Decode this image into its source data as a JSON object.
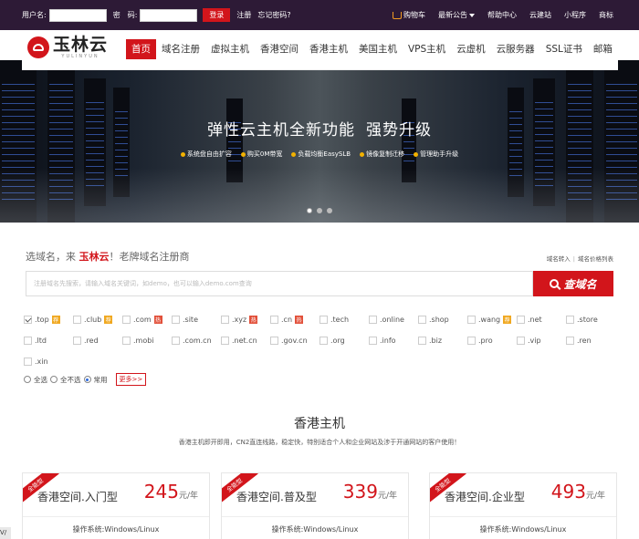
{
  "topbar": {
    "username_label": "用户名:",
    "password_label": "密　码:",
    "login_button": "登录",
    "register_link": "注册",
    "forgot_link": "忘记密码?",
    "cart": "购物车",
    "announcement": "最新公告",
    "help": "帮助中心",
    "cloud_site": "云建站",
    "mini_program": "小程序",
    "trademark": "商标"
  },
  "logo": {
    "text": "玉林云",
    "sub": "YULINYUN"
  },
  "nav": [
    {
      "label": "首页"
    },
    {
      "label": "域名注册"
    },
    {
      "label": "虚拟主机"
    },
    {
      "label": "香港空间"
    },
    {
      "label": "香港主机"
    },
    {
      "label": "美国主机"
    },
    {
      "label": "VPS主机"
    },
    {
      "label": "云虚机"
    },
    {
      "label": "云服务器"
    },
    {
      "label": "SSL证书"
    },
    {
      "label": "邮箱"
    }
  ],
  "banner": {
    "title": "弹性云主机全新功能",
    "title2": "强势升级",
    "features": [
      "系统盘自由扩容",
      "购买0M带宽",
      "负载均衡EasySLB",
      "镜像复制迁移",
      "管理助手升级"
    ]
  },
  "domain_search": {
    "title_prefix": "选域名，来",
    "brand": "玉林云",
    "title_suffix": "！老牌域名注册商",
    "link_transfer": "域名转入",
    "link_prices": "域名价格列表",
    "placeholder": "注册域名先搜索，请输入域名关键词，如demo，也可以输入demo.com查询",
    "button": "查域名",
    "tlds": [
      {
        "name": ".top",
        "checked": true,
        "badge": "荐"
      },
      {
        "name": ".club",
        "checked": false,
        "badge": "荐"
      },
      {
        "name": ".com",
        "checked": false,
        "badge": "热"
      },
      {
        "name": ".site",
        "checked": false,
        "badge": ""
      },
      {
        "name": ".xyz",
        "checked": false,
        "badge": "热"
      },
      {
        "name": ".cn",
        "checked": false,
        "badge": "热"
      },
      {
        "name": ".tech",
        "checked": false,
        "badge": ""
      },
      {
        "name": ".online",
        "checked": false,
        "badge": ""
      },
      {
        "name": ".shop",
        "checked": false,
        "badge": ""
      },
      {
        "name": ".wang",
        "checked": false,
        "badge": "荐"
      },
      {
        "name": ".net",
        "checked": false,
        "badge": ""
      },
      {
        "name": ".store",
        "checked": false,
        "badge": ""
      },
      {
        "name": ".ltd",
        "checked": false,
        "badge": ""
      },
      {
        "name": ".red",
        "checked": false,
        "badge": ""
      },
      {
        "name": ".mobi",
        "checked": false,
        "badge": ""
      },
      {
        "name": ".com.cn",
        "checked": false,
        "badge": ""
      },
      {
        "name": ".net.cn",
        "checked": false,
        "badge": ""
      },
      {
        "name": ".gov.cn",
        "checked": false,
        "badge": ""
      },
      {
        "name": ".org",
        "checked": false,
        "badge": ""
      },
      {
        "name": ".info",
        "checked": false,
        "badge": ""
      },
      {
        "name": ".biz",
        "checked": false,
        "badge": ""
      },
      {
        "name": ".pro",
        "checked": false,
        "badge": ""
      },
      {
        "name": ".vip",
        "checked": false,
        "badge": ""
      },
      {
        "name": ".ren",
        "checked": false,
        "badge": ""
      },
      {
        "name": ".xin",
        "checked": false,
        "badge": ""
      }
    ],
    "select_all": "全选",
    "select_none": "全不选",
    "common": "常用",
    "more": "更多>>"
  },
  "hk_hosting": {
    "title": "香港主机",
    "desc": "香港主机即开即用，CN2直连线路，稳定快，特别适合个人和企业网站及涉于开通网站的客户使用！",
    "plans": [
      {
        "ribbon": "全能型",
        "name": "香港空间.入门型",
        "price": "245",
        "unit": "元/年",
        "os": "操作系统:Windows/Linux"
      },
      {
        "ribbon": "全能型",
        "name": "香港空间.普及型",
        "price": "339",
        "unit": "元/年",
        "os": "操作系统:Windows/Linux"
      },
      {
        "ribbon": "全能型",
        "name": "香港空间.企业型",
        "price": "493",
        "unit": "元/年",
        "os": "操作系统:Windows/Linux"
      }
    ]
  },
  "side_tab": "V/",
  "colors": {
    "brand_red": "#d2151b",
    "topbar": "#2d1a36"
  }
}
